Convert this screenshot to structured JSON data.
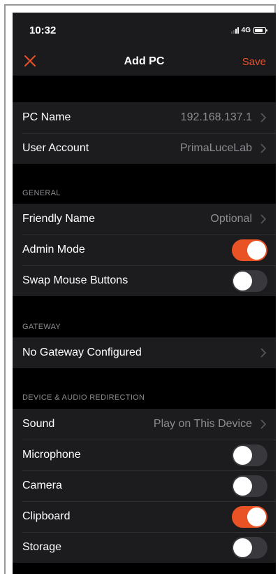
{
  "status_bar": {
    "time": "10:32",
    "network": "4G"
  },
  "nav": {
    "title": "Add PC",
    "save_label": "Save",
    "close_icon": "close-icon"
  },
  "colors": {
    "accent": "#e8502a",
    "background": "#000000",
    "cell": "#1c1c1e",
    "secondary_text": "#8d8d91"
  },
  "connection": {
    "pc_name": {
      "label": "PC Name",
      "value": "192.168.137.1"
    },
    "user_account": {
      "label": "User Account",
      "value": "PrimaLuceLab"
    }
  },
  "general": {
    "header": "GENERAL",
    "friendly_name": {
      "label": "Friendly Name",
      "value": "Optional"
    },
    "admin_mode": {
      "label": "Admin Mode",
      "on": true
    },
    "swap_mouse": {
      "label": "Swap Mouse Buttons",
      "on": false
    }
  },
  "gateway": {
    "header": "GATEWAY",
    "gateway_row": {
      "label": "No Gateway Configured"
    }
  },
  "redirection": {
    "header": "DEVICE & AUDIO REDIRECTION",
    "sound": {
      "label": "Sound",
      "value": "Play on This Device"
    },
    "microphone": {
      "label": "Microphone",
      "on": false
    },
    "camera": {
      "label": "Camera",
      "on": false
    },
    "clipboard": {
      "label": "Clipboard",
      "on": true
    },
    "storage": {
      "label": "Storage",
      "on": false
    }
  }
}
